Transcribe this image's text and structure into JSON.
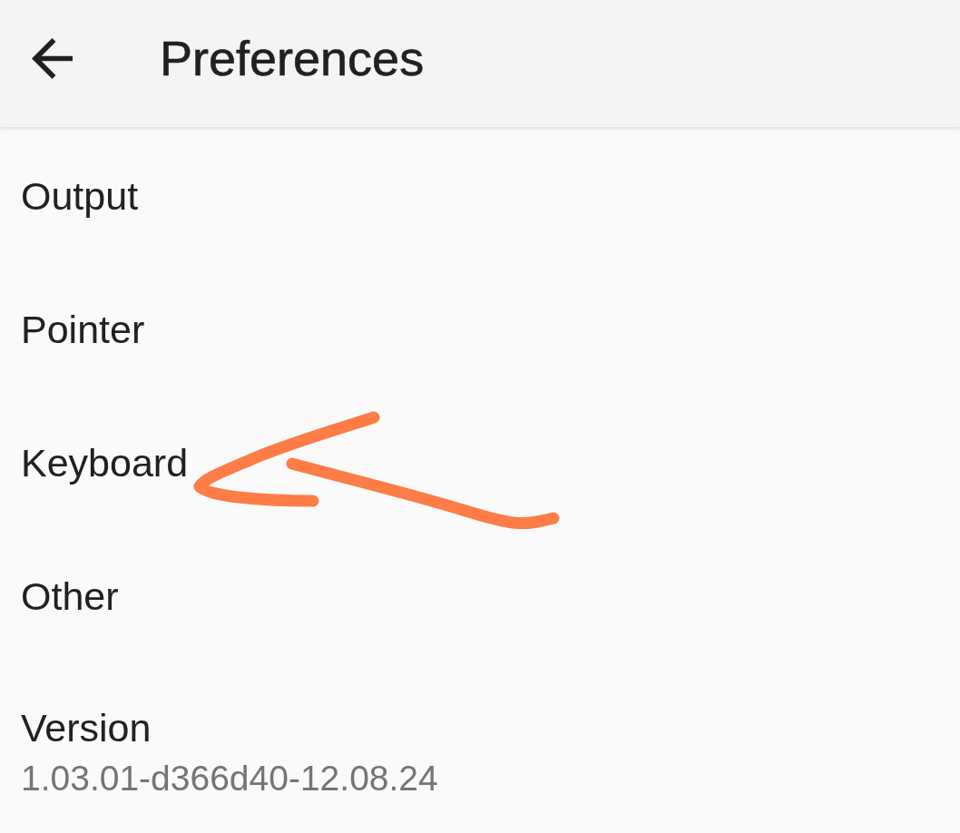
{
  "app_bar": {
    "title": "Preferences"
  },
  "items": [
    {
      "title": "Output",
      "annotated": false
    },
    {
      "title": "Pointer",
      "annotated": false
    },
    {
      "title": "Keyboard",
      "annotated": true
    },
    {
      "title": "Other",
      "annotated": false
    },
    {
      "title": "Version",
      "subtitle": "1.03.01-d366d40-12.08.24",
      "annotated": false
    }
  ]
}
